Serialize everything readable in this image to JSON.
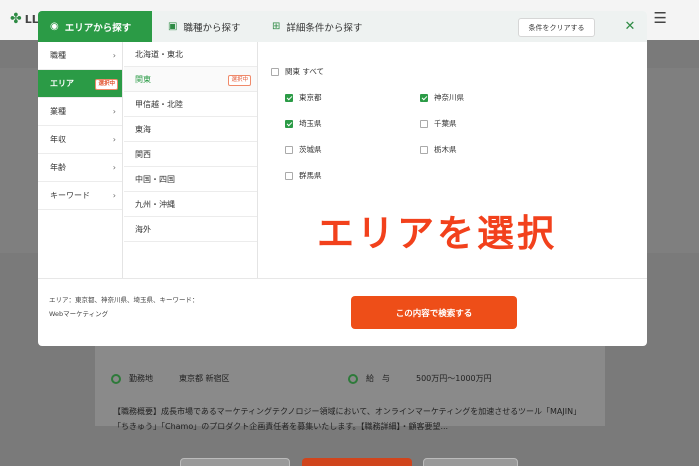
{
  "background": {
    "logo": "LLI",
    "location": {
      "label": "勤務地",
      "value": "東京都 新宿区"
    },
    "salary": {
      "label": "給　与",
      "value": "500万円〜1000万円"
    },
    "description": "【職務概要】成長市場であるマーケティングテクノロジー領域において、オンラインマーケティングを加速させるツール「MAJIN」「ちきゅう」「Chamo」のプロダクト企画責任者を募集いたします。【職務詳細】・顧客要望..."
  },
  "tabs": [
    {
      "label": "エリアから探す",
      "icon": "pin-icon"
    },
    {
      "label": "職種から探す",
      "icon": "briefcase-icon"
    },
    {
      "label": "詳細条件から探す",
      "icon": "plus-folder-icon"
    }
  ],
  "clear_label": "条件をクリアする",
  "selected_badge": "選択中",
  "categories": [
    "職種",
    "エリア",
    "業種",
    "年収",
    "年齢",
    "キーワード"
  ],
  "regions": [
    "北海道・東北",
    "関東",
    "甲信越・北陸",
    "東海",
    "関西",
    "中国・四国",
    "九州・沖縄",
    "海外"
  ],
  "all_label": "関東 すべて",
  "prefectures": [
    {
      "name": "東京都",
      "checked": true
    },
    {
      "name": "神奈川県",
      "checked": true
    },
    {
      "name": "埼玉県",
      "checked": true
    },
    {
      "name": "千葉県",
      "checked": false
    },
    {
      "name": "茨城県",
      "checked": false
    },
    {
      "name": "栃木県",
      "checked": false
    },
    {
      "name": "群馬県",
      "checked": false
    }
  ],
  "overlay_text": "エリアを選択",
  "conditions_line1": "エリア：東京都、神奈川県、埼玉県、キーワード：",
  "conditions_line2": "Webマーケティング",
  "search_label": "この内容で検索する",
  "colors": {
    "accent": "#2b9b46",
    "cta": "#ee4e18",
    "annotation": "#f2411c"
  }
}
